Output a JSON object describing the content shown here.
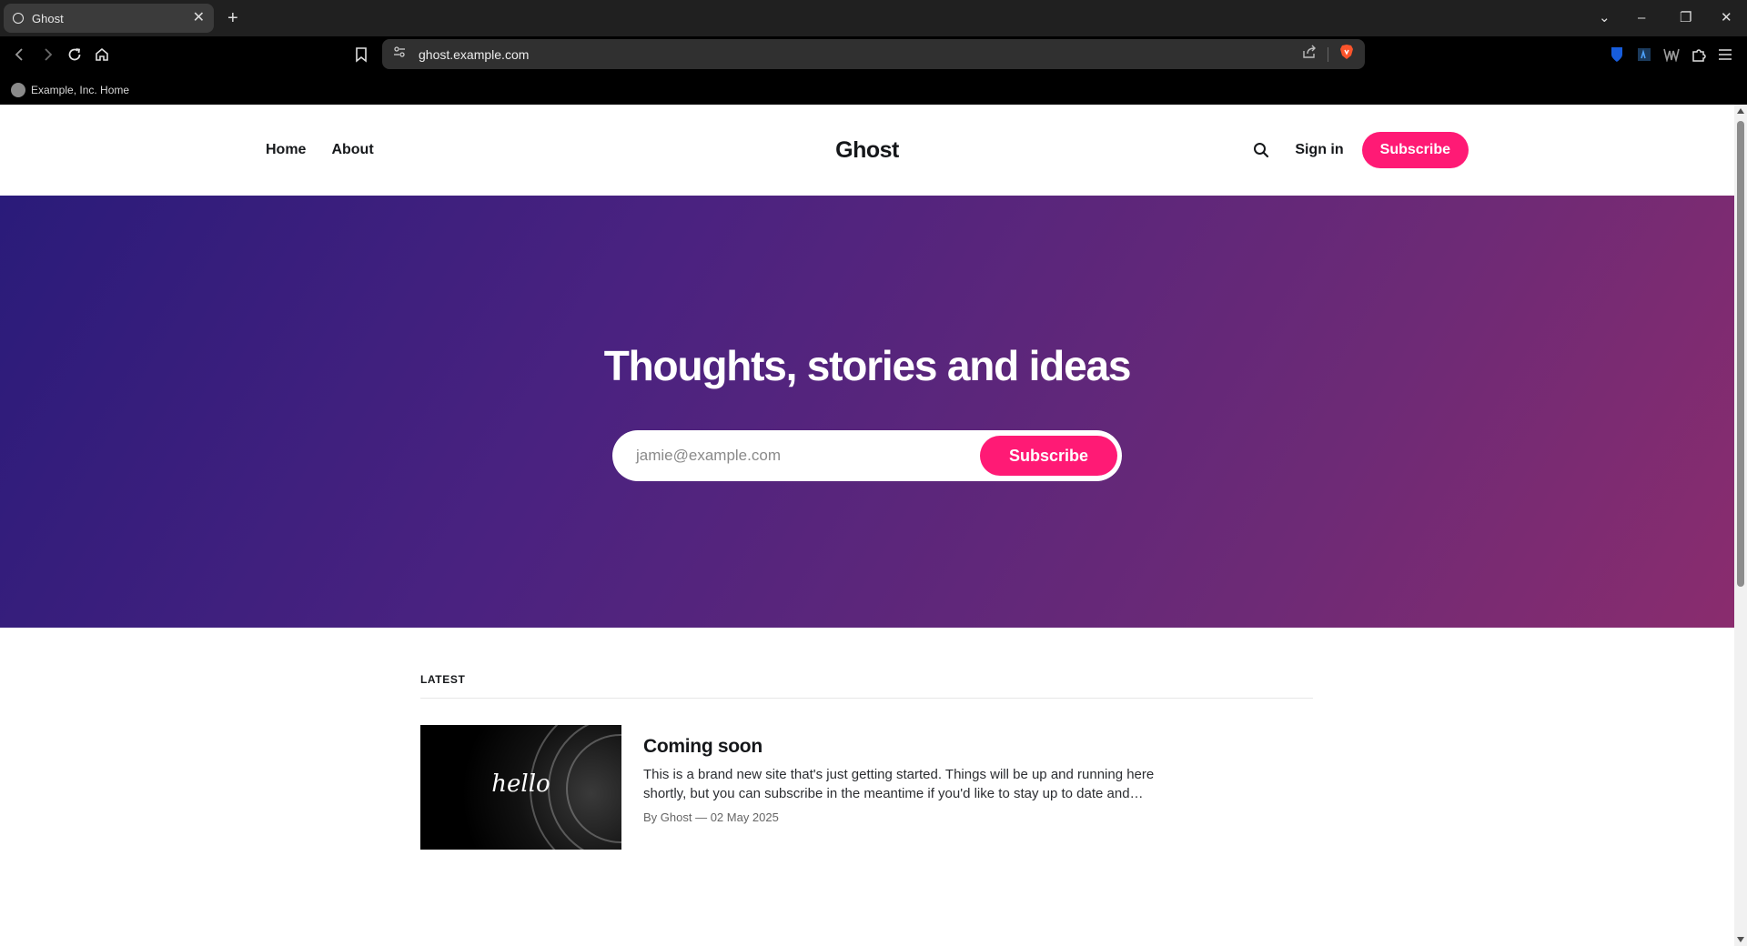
{
  "browser": {
    "tab_title": "Ghost",
    "tab_close": "✕",
    "new_tab": "+",
    "url": "ghost.example.com",
    "bookmark_label": "Example, Inc. Home",
    "window_controls": [
      "⌄",
      "–",
      "❐",
      "✕"
    ]
  },
  "site": {
    "nav": [
      "Home",
      "About"
    ],
    "title": "Ghost",
    "signin_label": "Sign in",
    "subscribe_label": "Subscribe"
  },
  "hero": {
    "heading": "Thoughts, stories and ideas",
    "email_placeholder": "jamie@example.com",
    "subscribe_label": "Subscribe"
  },
  "feed": {
    "section_label": "LATEST",
    "posts": [
      {
        "thumb_text": "hello",
        "title": "Coming soon",
        "excerpt": "This is a brand new site that's just getting started. Things will be up and running here shortly, but you can subscribe in the meantime if you'd like to stay up to date and…",
        "meta": "By Ghost — 02 May 2025"
      }
    ]
  },
  "colors": {
    "accent": "#ff1a75",
    "hero_gradient_start": "#2a1b7a",
    "hero_gradient_end": "#8a2c6e"
  },
  "icons": [
    "circle-favicon-icon",
    "back-icon",
    "forward-icon",
    "reload-icon",
    "home-icon",
    "bookmark-icon",
    "site-settings-icon",
    "share-icon",
    "brave-shield-icon",
    "bitwarden-icon",
    "extension-icon",
    "wallet-icon",
    "puzzle-icon",
    "menu-icon",
    "search-icon"
  ]
}
